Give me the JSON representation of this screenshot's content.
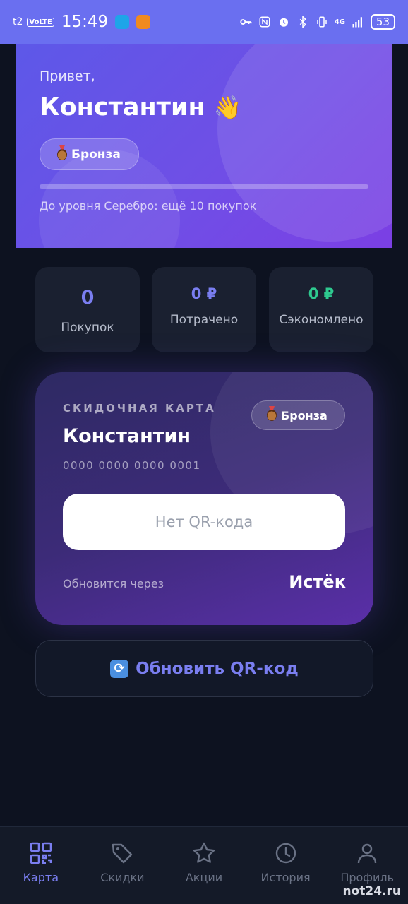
{
  "status_bar": {
    "carrier": "t2",
    "volte": "VoLTE",
    "time": "15:49",
    "network": "4G",
    "battery": "53"
  },
  "hero": {
    "greeting": "Привет,",
    "name": "Константин",
    "wave_emoji": "👋",
    "tier": "Бронза",
    "progress_fraction": 0.0,
    "level_text": "До уровня Серебро: ещё 10 покупок"
  },
  "stats": [
    {
      "value": "0",
      "label": "Покупок"
    },
    {
      "value": "0 ₽",
      "label": "Потрачено"
    },
    {
      "value": "0 ₽",
      "label": "Сэкономлено"
    }
  ],
  "card": {
    "label": "СКИДОЧНАЯ КАРТА",
    "tier": "Бронза",
    "name": "Константин",
    "number": "0000  0000  0000  0001",
    "qr_placeholder": "Нет QR-кода",
    "refresh_label": "Обновится через",
    "refresh_value": "Истёк"
  },
  "refresh_button": {
    "label": "Обновить QR-код"
  },
  "nav": [
    {
      "label": "Карта",
      "icon": "qr-icon",
      "active": true
    },
    {
      "label": "Скидки",
      "icon": "tag-icon",
      "active": false
    },
    {
      "label": "Акции",
      "icon": "star-icon",
      "active": false
    },
    {
      "label": "История",
      "icon": "clock-icon",
      "active": false
    },
    {
      "label": "Профиль",
      "icon": "user-icon",
      "active": false
    }
  ],
  "watermark": "not24.ru",
  "colors": {
    "accent": "#7a7ef0",
    "green": "#2ec98f",
    "background": "#0d1220"
  }
}
